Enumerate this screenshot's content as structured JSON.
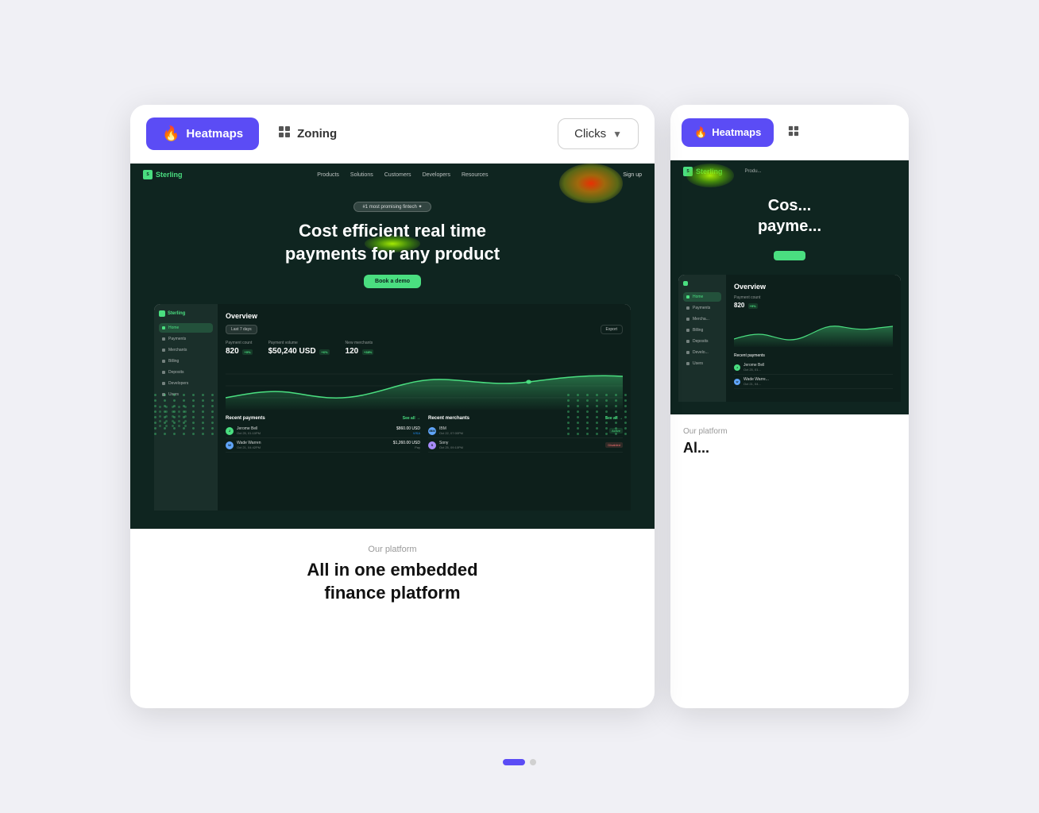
{
  "toolbar": {
    "heatmaps_label": "Heatmaps",
    "zoning_label": "Zoning",
    "clicks_label": "Clicks",
    "fire_icon": "🔥",
    "chevron_icon": "▼"
  },
  "hero": {
    "badge": "#1 most promising fintech ✦",
    "title_line1": "Cost efficient real time",
    "title_line2": "payments for any product",
    "cta": "Book a demo"
  },
  "metrics": {
    "payment_count_label": "Payment count",
    "payment_count_value": "820",
    "payment_count_badge": "+9%",
    "payment_volume_label": "Payment volume",
    "payment_volume_value": "$50,240 USD",
    "payment_volume_badge": "+6%",
    "new_merchants_label": "New merchants",
    "new_merchants_value": "120",
    "new_merchants_badge": "+38%"
  },
  "nav": {
    "links": [
      "Products",
      "Solutions",
      "Customers",
      "Developers",
      "Resources"
    ],
    "action": "Sign up"
  },
  "sidebar_nav": [
    {
      "label": "Home",
      "active": true
    },
    {
      "label": "Payments",
      "active": false
    },
    {
      "label": "Merchants",
      "active": false
    },
    {
      "label": "Billing",
      "active": false
    },
    {
      "label": "Deposits",
      "active": false
    },
    {
      "label": "Developers",
      "active": false
    },
    {
      "label": "Users",
      "active": false
    }
  ],
  "dashboard": {
    "title": "Overview",
    "filter_label": "Last 7 days",
    "export_label": "Export"
  },
  "recent_payments": {
    "title": "Recent payments",
    "see_all": "See all →",
    "items": [
      {
        "name": "Jerome Bell",
        "date": "Oct 25, 01:10PM",
        "amount": "$860.00 USD",
        "method": "VISA"
      },
      {
        "name": "Wade Warren",
        "date": "Oct 21, 04:42PM",
        "amount": "$1,260.00 USD",
        "method": "Pay"
      }
    ]
  },
  "recent_merchants": {
    "title": "Recent merchants",
    "see_all": "See all →",
    "items": [
      {
        "name": "IBM",
        "date": "Oct 22, 07:00PM",
        "status": "Active"
      },
      {
        "name": "Sony",
        "date": "Oct 25, 09:10PM",
        "status": "Disabled"
      }
    ]
  },
  "bottom": {
    "platform_label": "Our platform",
    "platform_title_line1": "All in one embedded",
    "platform_title_line2": "finance platform"
  },
  "side_bottom": {
    "title": "Al..."
  },
  "pagination": {
    "active_index": 0,
    "total": 2
  }
}
